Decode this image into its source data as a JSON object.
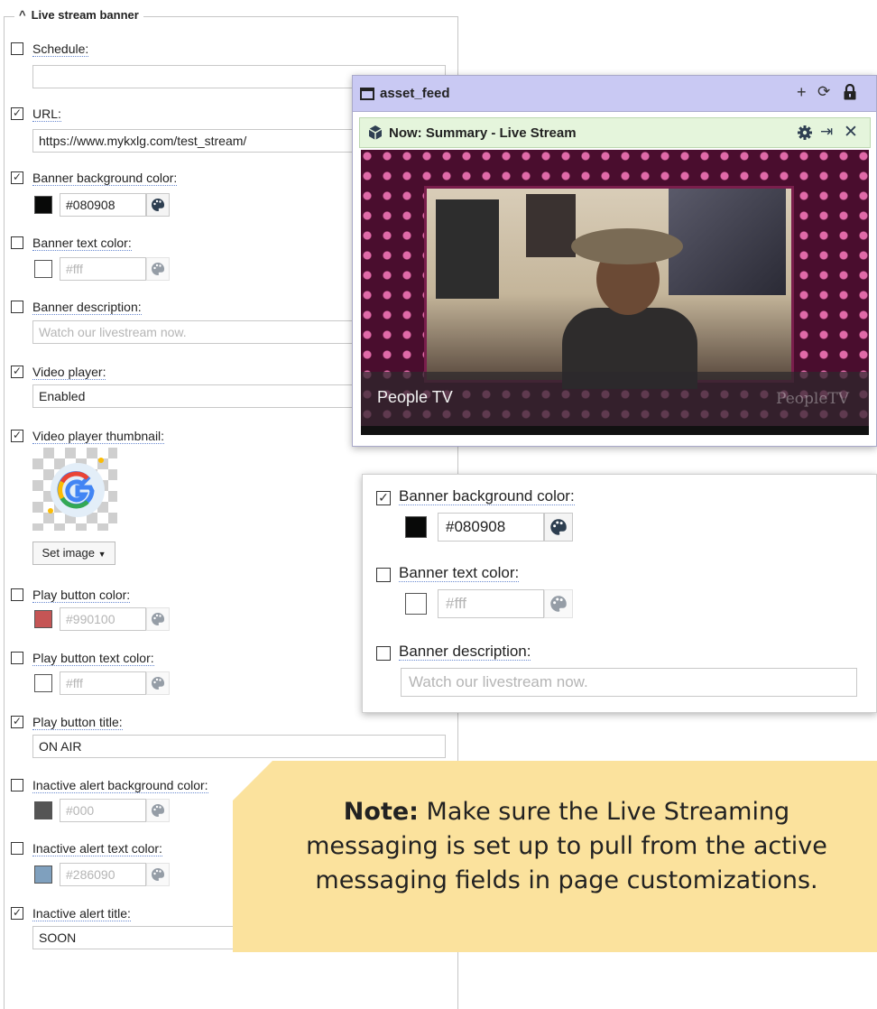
{
  "panel": {
    "legend": "Live stream banner",
    "fields": {
      "schedule": {
        "label": "Schedule:",
        "checked": false,
        "value": ""
      },
      "url": {
        "label": "URL:",
        "checked": true,
        "value": "https://www.mykxlg.com/test_stream/"
      },
      "banner_bg": {
        "label": "Banner background color:",
        "checked": true,
        "hex": "#080908",
        "swatch": "#080908"
      },
      "banner_text": {
        "label": "Banner text color:",
        "checked": false,
        "hex": "#fff",
        "swatch": "#ffffff"
      },
      "banner_desc": {
        "label": "Banner description:",
        "checked": false,
        "placeholder": "Watch our livestream now."
      },
      "video_player": {
        "label": "Video player:",
        "checked": true,
        "value": "Enabled"
      },
      "video_thumb": {
        "label": "Video player thumbnail:",
        "checked": true,
        "button": "Set image"
      },
      "play_color": {
        "label": "Play button color:",
        "checked": false,
        "hex": "#990100",
        "swatch": "#c55555"
      },
      "play_text_color": {
        "label": "Play button text color:",
        "checked": false,
        "hex": "#fff",
        "swatch": "#ffffff"
      },
      "play_title": {
        "label": "Play button title:",
        "checked": true,
        "value": "ON AIR"
      },
      "inactive_bg": {
        "label": "Inactive alert background color:",
        "checked": false,
        "hex": "#000",
        "swatch": "#555555"
      },
      "inactive_text": {
        "label": "Inactive alert text color:",
        "checked": false,
        "hex": "#286090",
        "swatch": "#7fa0be"
      },
      "inactive_title": {
        "label": "Inactive alert title:",
        "checked": true,
        "value": "SOON"
      }
    }
  },
  "asset_feed": {
    "title": "asset_feed",
    "now_title": "Now: Summary - Live Stream",
    "caption": "People TV",
    "caption_logo": "PeopleTV"
  },
  "zoom": {
    "banner_bg": {
      "label": "Banner background color:",
      "hex": "#080908"
    },
    "banner_text": {
      "label": "Banner text color:",
      "hex": "#fff"
    },
    "banner_desc": {
      "label": "Banner description:",
      "placeholder": "Watch our livestream now."
    }
  },
  "note": {
    "lead": "Note:",
    "line1": " Make sure the Live Streaming",
    "line2": "messaging is set up to pull from the active",
    "line3": "messaging fields in page customizations."
  },
  "colors": {
    "header_bg": "#c9c9f3",
    "now_bar_bg": "#e5f5dc",
    "note_bg": "#fbe29d",
    "label_underline": "#6a8ad0"
  },
  "icons": [
    "caret-up-icon",
    "checkbox-icon",
    "palette-icon",
    "window-icon",
    "plus-icon",
    "refresh-icon",
    "lock-icon",
    "cube-icon",
    "gear-icon",
    "pin-icon",
    "close-icon",
    "dropdown-caret-icon"
  ]
}
